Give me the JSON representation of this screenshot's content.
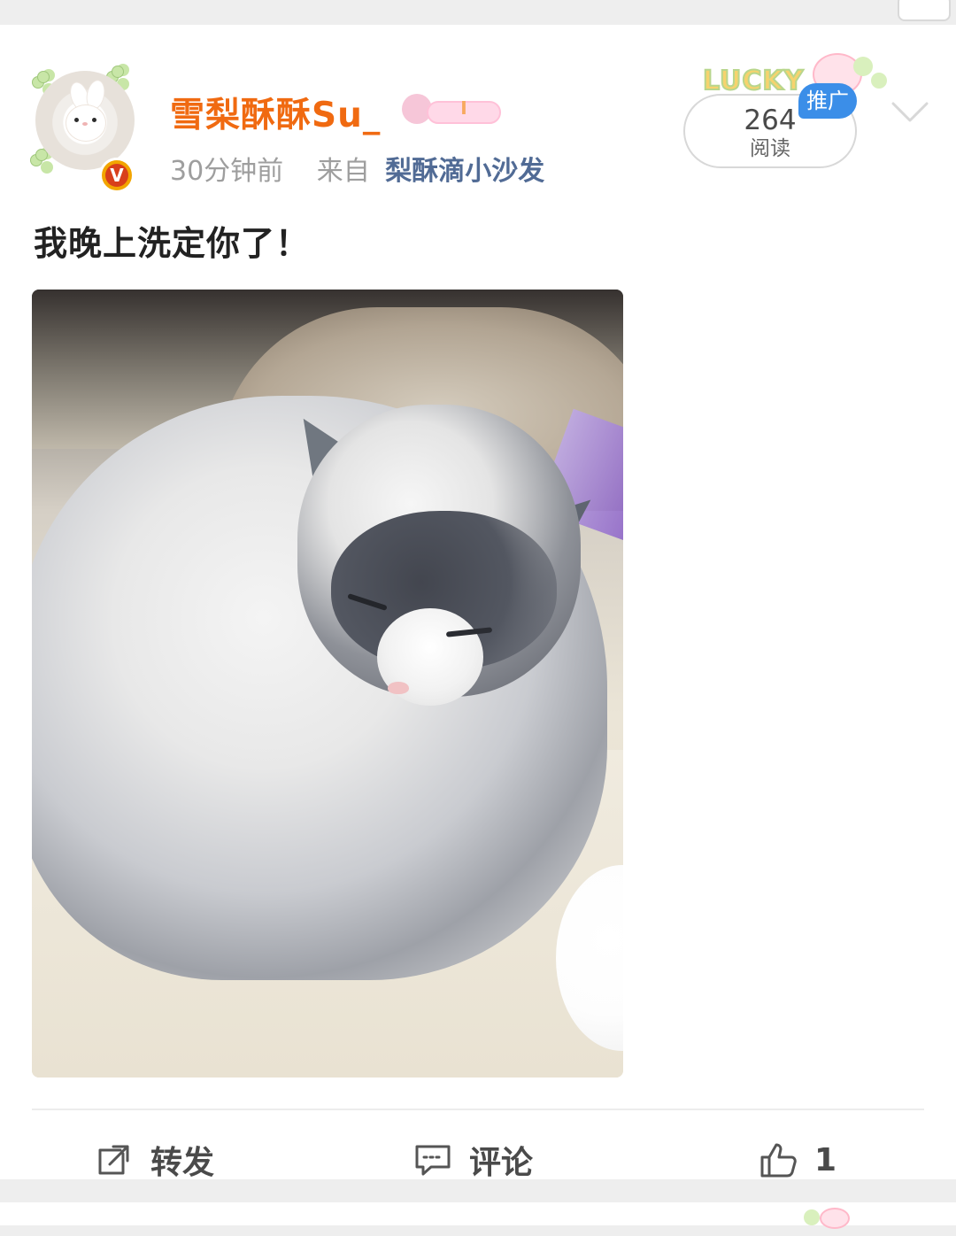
{
  "post": {
    "username": "雪梨酥酥Su_",
    "time": "30分钟前",
    "from_label": "来自",
    "source": "梨酥滴小沙发",
    "read_count": "264",
    "read_label": "阅读",
    "promo_badge": "推广",
    "text": "我晚上洗定你了！",
    "image_icon_name": "cat-photo",
    "actions": {
      "repost_label": "转发",
      "comment_label": "评论",
      "like_count": "1"
    },
    "decor": {
      "lucky_text": "LUCKY",
      "verified_badge": "V",
      "deco_mark": "I"
    }
  },
  "colors": {
    "username": "#f06a11",
    "source": "#516b95",
    "promo_badge": "#3b8ee8",
    "verified_badge_outer": "#f2a500",
    "verified_badge_inner": "#d83f1b"
  },
  "icons": {
    "avatar": "avatar-image",
    "repost": "repost-icon",
    "comment": "comment-icon",
    "like": "thumbs-up-icon",
    "more": "chevron-down-icon"
  }
}
